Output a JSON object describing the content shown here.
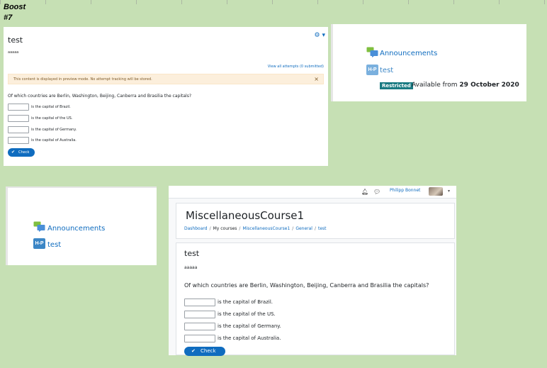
{
  "sheet": {
    "heading": "Boost",
    "subheading": "#7"
  },
  "panel_preview": {
    "title": "test",
    "gear_icon": "gear-icon",
    "gear_caret": "▾",
    "description": "aaaaa",
    "view_attempts": "View all attempts (0 submitted)",
    "alert_text": "This content is displayed in preview mode. No attempt tracking will be stored.",
    "alert_close": "×",
    "question": "Of which countries are Berlin, Washington, Beijing, Canberra and Brasilia the capitals?",
    "answers": [
      "is the capital of Brazil.",
      "is the capital of the US.",
      "is the capital of Germany.",
      "is the capital of Australia."
    ],
    "check_label": "Check"
  },
  "panel_restricted": {
    "announcements": "Announcements",
    "hp_icon_text": "H-P",
    "test_label": "test",
    "badge": "Restricted",
    "available_prefix": "Available from",
    "available_date": "29 October 2020"
  },
  "panel_list": {
    "announcements": "Announcements",
    "hp_icon_text": "H-P",
    "test_label": "test"
  },
  "panel_course": {
    "navbar": {
      "user_name": "Philipp Bonnet",
      "caret": "▾"
    },
    "course_title": "MiscellaneousCourse1",
    "breadcrumb": [
      "Dashboard",
      "My courses",
      "MiscellaneousCourse1",
      "General",
      "test"
    ],
    "breadcrumb_sep": "/",
    "activity_title": "test",
    "description": "aaaaa",
    "question": "Of which countries are Berlin, Washington, Beijing, Canberra and Brasilia the capitals?",
    "answers": [
      "is the capital of Brazil.",
      "is the capital of the US.",
      "is the capital of Germany.",
      "is the capital of Australia."
    ],
    "check_label": "Check"
  }
}
